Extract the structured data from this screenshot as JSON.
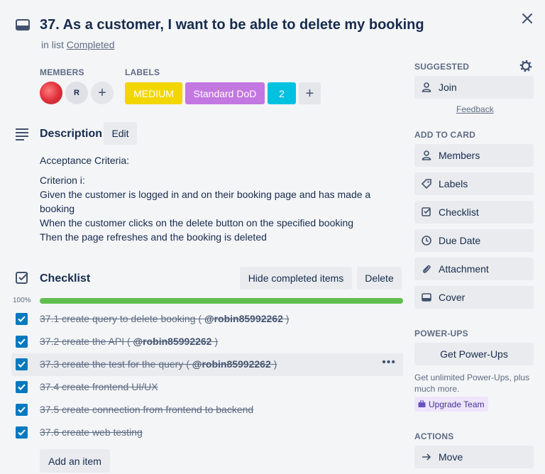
{
  "card": {
    "title": "37. As a customer, I want to be able to delete my booking",
    "in_list_prefix": "in list",
    "list_name": "Completed"
  },
  "members": {
    "label": "MEMBERS",
    "initial": "R"
  },
  "labels": {
    "label": "LABELS",
    "items": [
      {
        "text": "MEDIUM",
        "color": "#f2d600"
      },
      {
        "text": "Standard DoD",
        "color": "#c377e0"
      },
      {
        "text": "2",
        "color": "#00c2e0"
      }
    ]
  },
  "description": {
    "heading": "Description",
    "edit_label": "Edit",
    "paragraphs": [
      "Acceptance Criteria:",
      "Criterion i:\nGiven the customer is logged in and on their booking page and has made a booking\nWhen the customer clicks on the delete button on the specified booking\nThen the page refreshes and the booking is deleted"
    ]
  },
  "checklist": {
    "heading": "Checklist",
    "hide_label": "Hide completed items",
    "delete_label": "Delete",
    "percent": "100%",
    "progress": 1.0,
    "items": [
      {
        "text": "37.1 create query to delete booking ( ",
        "mention": "@robin85992262",
        "tail": " )",
        "checked": true
      },
      {
        "text": "37.2 create the API ( ",
        "mention": "@robin85992262",
        "tail": " )",
        "checked": true
      },
      {
        "text": "37.3 create the test for the query ( ",
        "mention": "@robin85992262",
        "tail": " )",
        "checked": true
      },
      {
        "text": "37.4 create frontend UI/UX",
        "mention": "",
        "tail": "",
        "checked": true
      },
      {
        "text": "37.5 create connection from frontend to backend",
        "mention": "",
        "tail": "",
        "checked": true
      },
      {
        "text": "37.6 create web testing",
        "mention": "",
        "tail": "",
        "checked": true
      }
    ],
    "add_item_label": "Add an item",
    "more_label": "•••"
  },
  "sidebar": {
    "suggested_label": "SUGGESTED",
    "join_label": "Join",
    "feedback_label": "Feedback",
    "add_to_card_label": "ADD TO CARD",
    "add_items": [
      "Members",
      "Labels",
      "Checklist",
      "Due Date",
      "Attachment",
      "Cover"
    ],
    "powerups_label": "POWER-UPS",
    "get_powerups_label": "Get Power-Ups",
    "powerups_note": "Get unlimited Power-Ups, plus much more.",
    "upgrade_label": "Upgrade Team",
    "actions_label": "ACTIONS",
    "move_label": "Move"
  }
}
